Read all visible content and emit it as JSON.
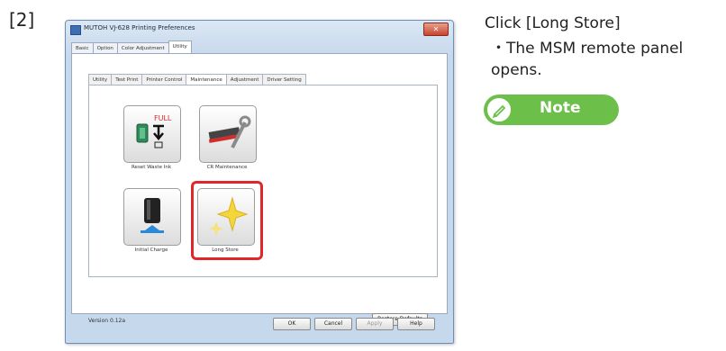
{
  "step": "[2]",
  "window": {
    "title": "MUTOH VJ-628 Printing Preferences",
    "close_label": "✕"
  },
  "top_tabs": [
    "Basic",
    "Option",
    "Color Adjustment",
    "Utility"
  ],
  "sub_tabs": [
    "Utility",
    "Test Print",
    "Printer Control",
    "Maintenance",
    "Adjustment",
    "Driver Setting"
  ],
  "tiles": {
    "reset_waste_ink": "Reset Waste Ink",
    "cr_maintenance": "CR Maintenance",
    "initial_charge": "Initial Charge",
    "long_store": "Long Store"
  },
  "version": "Version 0.12a",
  "buttons": {
    "restore_defaults": "Restore Defaults",
    "ok": "OK",
    "cancel": "Cancel",
    "apply": "Apply",
    "help": "Help"
  },
  "instructions": {
    "title": "Click [Long Store]",
    "bullet": "・The MSM remote panel opens.",
    "note": "Note"
  },
  "colors": {
    "highlight": "#e0262b",
    "note_green": "#6cc04a"
  }
}
